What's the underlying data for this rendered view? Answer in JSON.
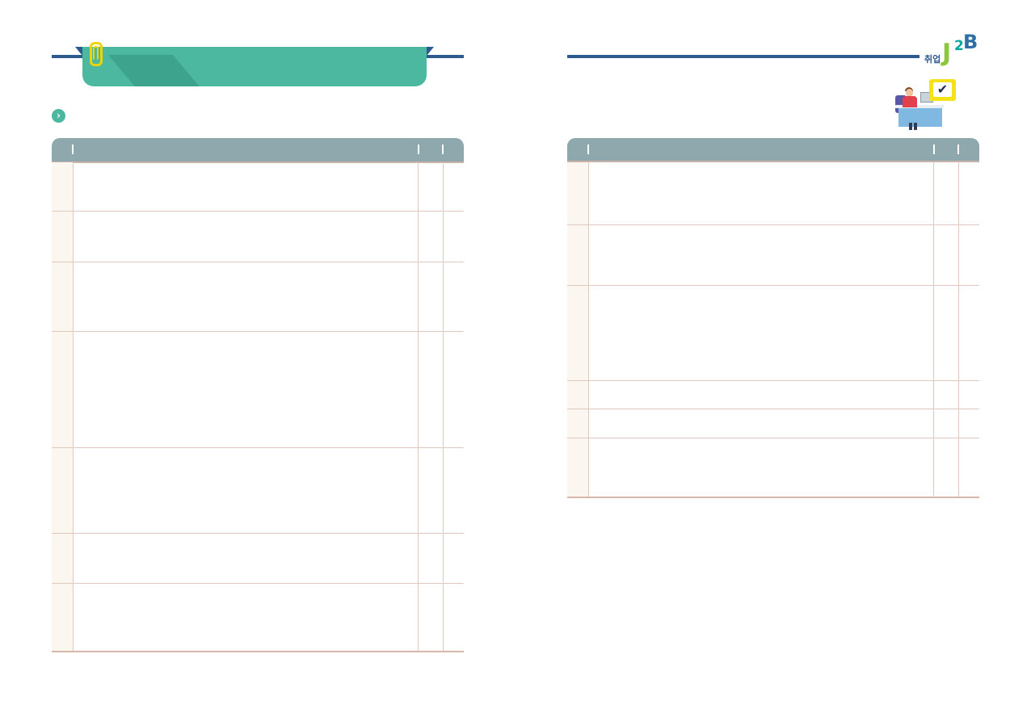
{
  "left_page": {
    "section_icon": "paperclip-icon",
    "bullet_icon": "chevron-right-circle-icon",
    "header_title": "",
    "section_subtitle": "",
    "table": {
      "column_headers": [
        "",
        "",
        ""
      ],
      "row_count": 7
    }
  },
  "right_page": {
    "logo_small_text": "",
    "logo_text_korean": "취업",
    "logo_text_j": "J",
    "logo_text_2": "2",
    "logo_text_b": "B",
    "illustration_icon": "office-worker-checklist-icon",
    "check_glyph": "✔",
    "table": {
      "column_headers": [
        "",
        "",
        ""
      ],
      "row_count": 6
    }
  },
  "colors": {
    "accent_teal": "#4db8a0",
    "navy_line": "#2e5b8f",
    "table_header": "#8ea8ad",
    "row_border": "#e2c9bd",
    "number_column_bg": "#fbf6ef",
    "clip_yellow": "#f0d400"
  }
}
